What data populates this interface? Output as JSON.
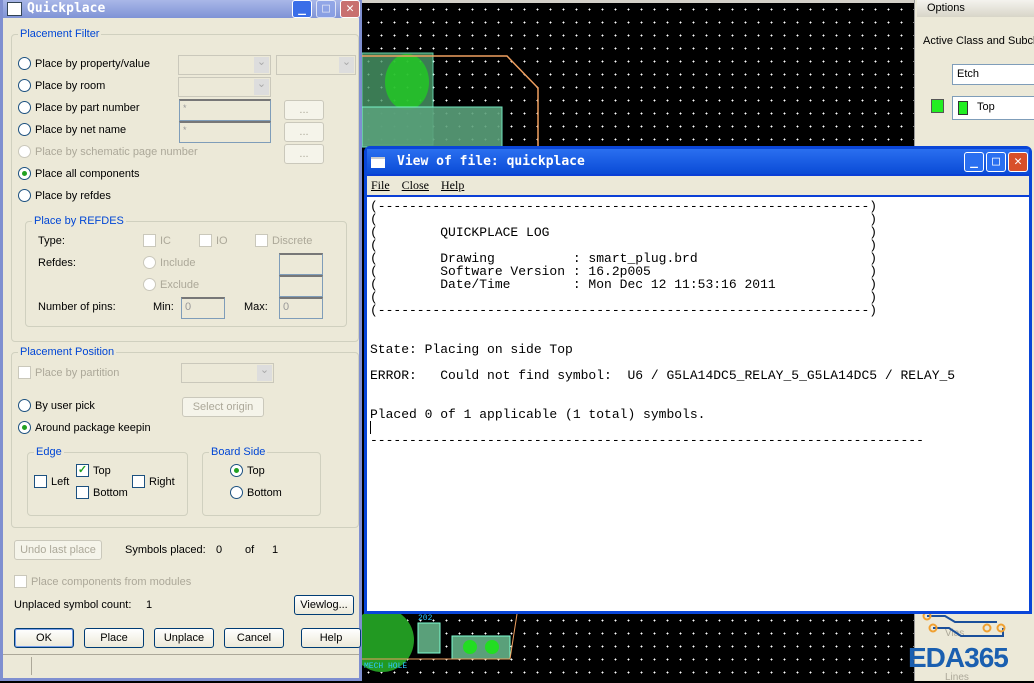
{
  "quickplace": {
    "title": "Quickplace",
    "filter": {
      "legend": "Placement Filter",
      "options": [
        "Place by property/value",
        "Place by room",
        "Place by part number",
        "Place by net name",
        "Place by schematic page number",
        "Place all components",
        "Place by refdes"
      ],
      "part_number_value": "*",
      "net_name_value": "*",
      "browse": "..."
    },
    "refdes": {
      "legend": "Place by REFDES",
      "type_label": "Type:",
      "ic": "IC",
      "io": "IO",
      "discrete": "Discrete",
      "refdes_label": "Refdes:",
      "include": "Include",
      "exclude": "Exclude",
      "pins_label": "Number of pins:",
      "min_label": "Min:",
      "min": "0",
      "max_label": "Max:",
      "max": "0"
    },
    "position": {
      "legend": "Placement Position",
      "partition": "Place by partition",
      "user_pick": "By user pick",
      "select_origin": "Select origin",
      "around_keepin": "Around package keepin",
      "edge": {
        "legend": "Edge",
        "left": "Left",
        "top": "Top",
        "bottom": "Bottom",
        "right": "Right"
      },
      "side": {
        "legend": "Board Side",
        "top": "Top",
        "bottom": "Bottom"
      }
    },
    "undo": "Undo last place",
    "symbols_placed_label": "Symbols placed:",
    "placed": "0",
    "of": "of",
    "total": "1",
    "modules": "Place components from modules",
    "unplaced_label": "Unplaced symbol count:",
    "unplaced": "1",
    "viewlog": "Viewlog...",
    "buttons": {
      "ok": "OK",
      "place": "Place",
      "unplace": "Unplace",
      "cancel": "Cancel",
      "help": "Help"
    }
  },
  "options": {
    "title": "Options",
    "active_label": "Active Class and Subcla",
    "class": "Etch",
    "subclass": "Top",
    "visible_items": [
      "Vias",
      "Lines"
    ]
  },
  "viewer": {
    "title": "View of file: quickplace",
    "menu": [
      "File",
      "Close",
      "Help"
    ],
    "log": [
      "(---------------------------------------------------------------)",
      "(                                                               )",
      "(        QUICKPLACE LOG                                         )",
      "(                                                               )",
      "(        Drawing          : smart_plug.brd                      )",
      "(        Software Version : 16.2p005                            )",
      "(        Date/Time        : Mon Dec 12 11:53:16 2011            )",
      "(                                                               )",
      "(---------------------------------------------------------------)",
      "",
      "",
      "State: Placing on side Top",
      "",
      "ERROR:   Could not find symbol:  U6 / G5LA14DC5_RELAY_5_G5LA14DC5 / RELAY_5",
      "",
      "",
      "Placed 0 of 1 applicable (1 total) symbols.",
      "",
      "-----------------------------------------------------------------------"
    ]
  },
  "board": {
    "labels": [
      "MECH HOLE",
      "202"
    ]
  },
  "watermark": "EDA365",
  "colors": {
    "etch": "#22ee22",
    "title_blue": "#0a4bd6",
    "legend_blue": "#0046d5",
    "outline": "#f0a060"
  }
}
